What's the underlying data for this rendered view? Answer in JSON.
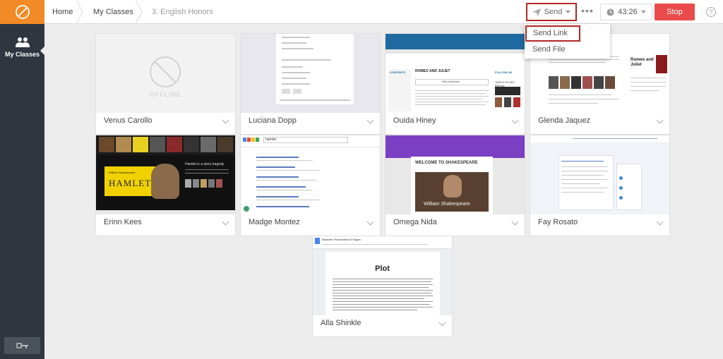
{
  "sidebar": {
    "nav_label": "My Classes"
  },
  "header": {
    "breadcrumbs": [
      "Home",
      "My Classes",
      "3. English Honors"
    ],
    "send_label": "Send",
    "timer": "43:26",
    "stop_label": "Stop",
    "help": "?"
  },
  "send_menu": {
    "items": [
      "Send Link",
      "Send File"
    ]
  },
  "students": [
    {
      "name": "Venus Carollo",
      "status": "OFFLINE"
    },
    {
      "name": "Luciana Dopp"
    },
    {
      "name": "Ouida Hiney"
    },
    {
      "name": "Glenda Jaquez"
    },
    {
      "name": "Erinn Kees"
    },
    {
      "name": "Madge Montez"
    },
    {
      "name": "Omega Nida"
    },
    {
      "name": "Fay Rosato"
    },
    {
      "name": "Alla Shinkle"
    }
  ],
  "thumbs": {
    "hiney_title": "ROMEO AND JULIET",
    "hiney_contents": "CONTENTS",
    "hiney_section": "Plot Overview",
    "hiney_follow": "FOLLOW US",
    "hiney_break": "TAKE A STUDY BREAK",
    "jaquez_title": "Romeo and Juliet",
    "kees_title": "HAMLET",
    "kees_author": "William Shakespeare",
    "kees_heading": "Hamlet is a story tragedy",
    "montez_search": "hamlet",
    "nida_heading": "WELCOME TO SHAKESPEARE",
    "nida_caption": "William Shakespeare",
    "shinkle_doc_title": "Macbeth Presentation 5 Pages",
    "shinkle_heading": "Plot"
  },
  "colors": {
    "accent": "#f28a25",
    "sidebar": "#2f3640",
    "stop": "#e94b4b",
    "highlight": "#b22727"
  }
}
